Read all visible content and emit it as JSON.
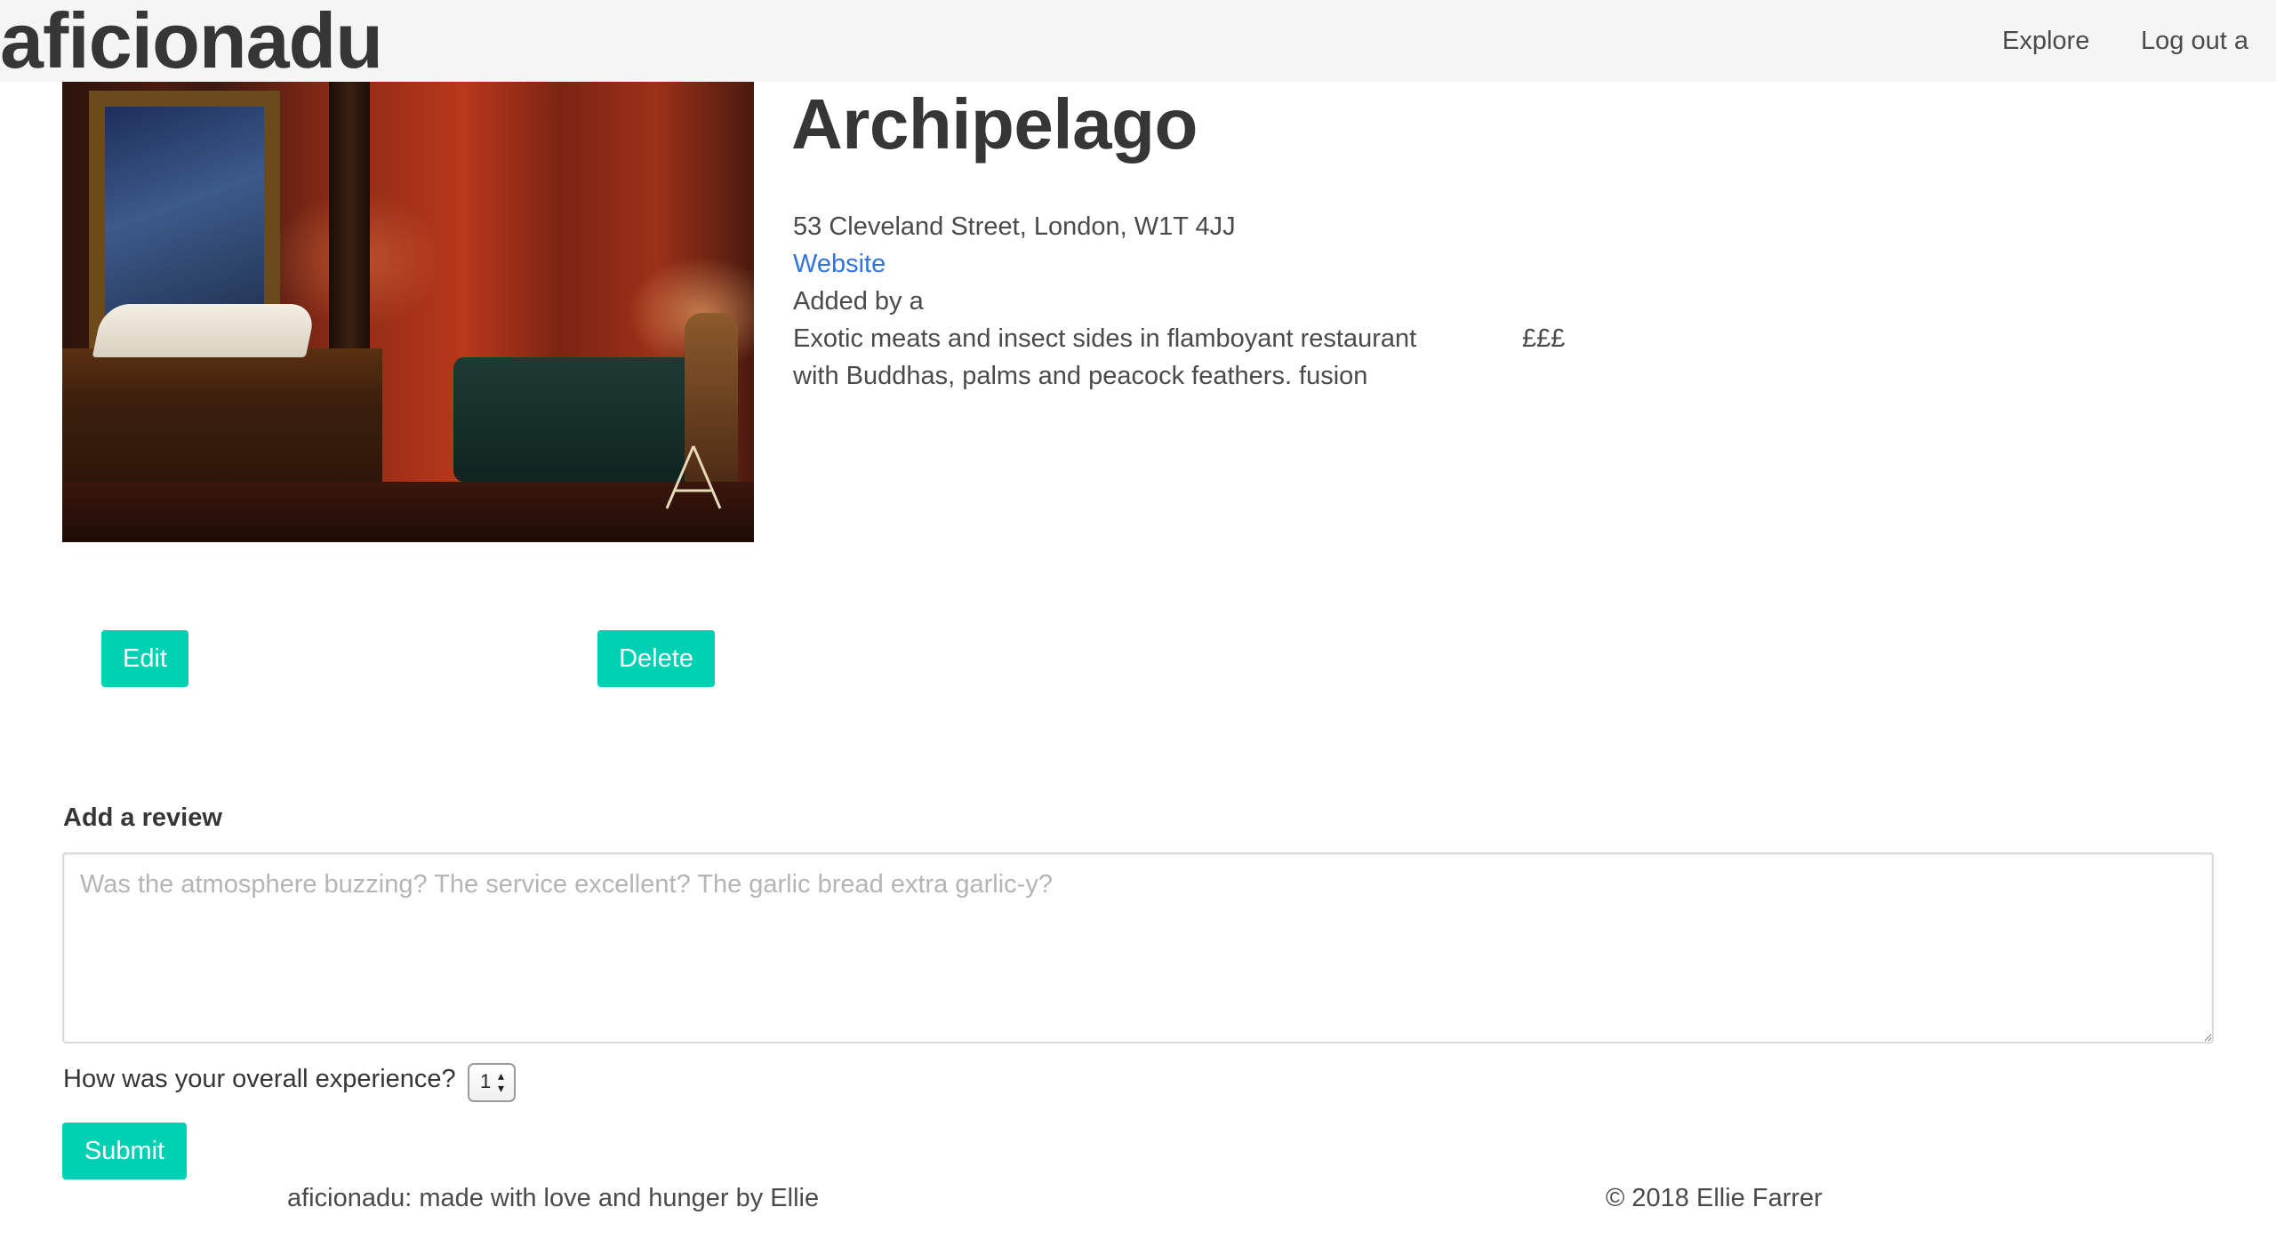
{
  "navbar": {
    "brand": "aficionadu",
    "links": [
      {
        "label": "Explore"
      },
      {
        "label": "Log out a"
      }
    ]
  },
  "restaurant": {
    "name": "Archipelago",
    "photo_alt": "Archipelago restaurant interior",
    "address": "53 Cleveland Street, London, W1T 4JJ",
    "website_label": "Website",
    "added_by": "Added by a",
    "description": "Exotic meats and insect sides in flamboyant restaurant with Buddhas, palms and peacock feathers. fusion",
    "price": "£££"
  },
  "actions": {
    "edit_label": "Edit",
    "delete_label": "Delete"
  },
  "review_form": {
    "heading": "Add a review",
    "placeholder": "Was the atmosphere buzzing? The service excellent? The garlic bread extra garlic-y?",
    "experience_label": "How was your overall experience?",
    "rating_value": "1",
    "submit_label": "Submit"
  },
  "footer": {
    "left": "aficionadu: made with love and hunger by Ellie",
    "right": "© 2018 Ellie Farrer"
  },
  "colors": {
    "accent": "#00d1b2",
    "link": "#3273dc",
    "navbar_bg": "#f5f5f5",
    "text": "#363636"
  },
  "icons": {
    "select_arrows": "chevron-up-down-icon"
  }
}
